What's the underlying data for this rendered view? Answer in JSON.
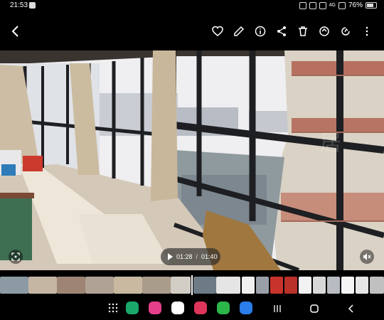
{
  "status_bar": {
    "time": "21:53",
    "network": "4G",
    "battery": "76%"
  },
  "toolbar": {
    "back_icon": "back-chevron-icon",
    "actions": [
      "heart-icon",
      "edit-pencil-icon",
      "info-icon",
      "share-icon",
      "delete-icon",
      "rotate-icon",
      "remaster-icon",
      "more-vert-icon"
    ]
  },
  "video": {
    "current_time": "01:28",
    "separator": "/",
    "total_time": "01:40",
    "watermark_text": "居"
  },
  "colors": {
    "background": "#000000",
    "control_bg": "rgba(40,40,40,0.65)",
    "sky": "#f0f3f6",
    "window_frame": "#1e1f22",
    "floor": "#d6ccbf",
    "curtain": "#cfbfa7"
  },
  "navbar": {
    "apps": [
      "dialer-app-icon",
      "flower-app-icon",
      "camera-app-icon",
      "video-app-icon",
      "wechat-app-icon",
      "chat-app-icon"
    ],
    "buttons": [
      "recents-icon",
      "home-icon",
      "back-icon"
    ]
  }
}
